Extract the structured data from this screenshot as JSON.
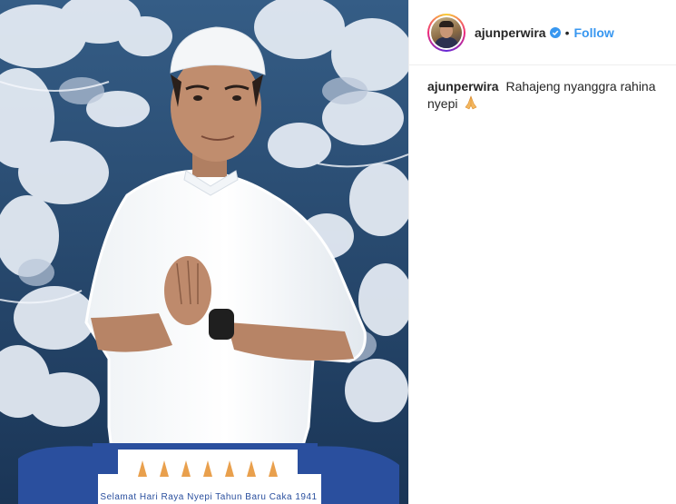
{
  "post": {
    "username": "ajunperwira",
    "separator": "•",
    "follow_label": "Follow",
    "caption_user": "ajunperwira",
    "caption_text": "Rahajeng nyanggra rahina nyepi",
    "caption_emoji": "folded-hands-icon"
  },
  "image": {
    "banner_text": "Selamat Hari Raya Nyepi Tahun Baru Caka 1941",
    "colors": {
      "banner_blue": "#2a4f9e",
      "foliage": "#e6ecf4",
      "background_blue": "#1f3f66",
      "verified_blue": "#3897f0",
      "follow_blue": "#3897f0"
    }
  }
}
